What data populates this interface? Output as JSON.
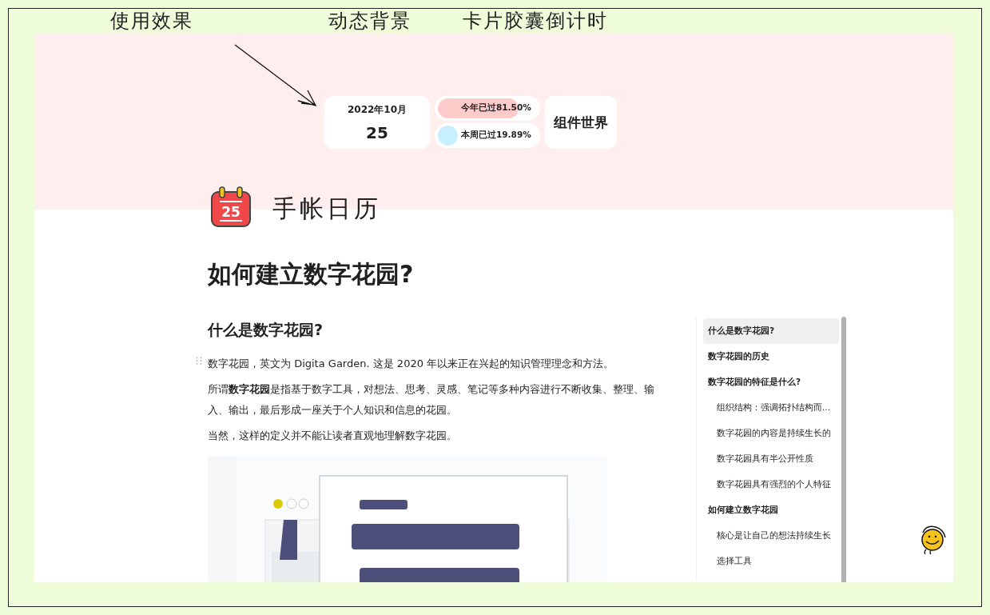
{
  "annotations": [
    {
      "text": "使用效果"
    },
    {
      "text": "动态背景"
    },
    {
      "text": "卡片胶囊倒计时"
    }
  ],
  "widgets": {
    "date": {
      "month": "2022年10月",
      "day": "25"
    },
    "progress": [
      {
        "label": "今年已过81.50%",
        "level": 0.815,
        "color": "#ffcaca"
      },
      {
        "label": "本周已过19.89%",
        "level": 0.1989,
        "color": "#c8efff"
      }
    ],
    "brand": "组件世界"
  },
  "page": {
    "icon_day": "25",
    "name": "手帐日历",
    "title": "如何建立数字花园?"
  },
  "article": {
    "heading": "什么是数字花园?",
    "paragraphs": [
      "数字花园，英文为 Digita Garden. 这是 2020 年以来正在兴起的知识管理理念和方法。",
      "所谓**数字花园**是指基于数字工具，对想法、思考、灵感、笔记等多种内容进行不断收集、整理、输入、输出，最后形成一座关于个人知识和信息的花园。",
      "当然，这样的定义并不能让读者直观地理解数字花园。"
    ],
    "image": {
      "kind": "picture"
    }
  },
  "toc": [
    {
      "label": "什么是数字花园?",
      "selected": true
    },
    {
      "label": "数字花园的历史",
      "selected": false
    },
    {
      "label": "数字花园的特征是什么?",
      "selected": false,
      "children": [
        {
          "label": "组织结构：强调拓扑结构而...",
          "selected": false
        },
        {
          "label": "数字花园的内容是持续生长的",
          "selected": false
        },
        {
          "label": "数字花园具有半公开性质",
          "selected": false
        },
        {
          "label": "数字花园具有强烈的个人特征",
          "selected": false
        }
      ]
    },
    {
      "label": "如何建立数字花园",
      "selected": false,
      "children": [
        {
          "label": "核心是让自己的想法持续生长",
          "selected": false
        },
        {
          "label": "选择工具",
          "selected": false
        }
      ]
    }
  ]
}
